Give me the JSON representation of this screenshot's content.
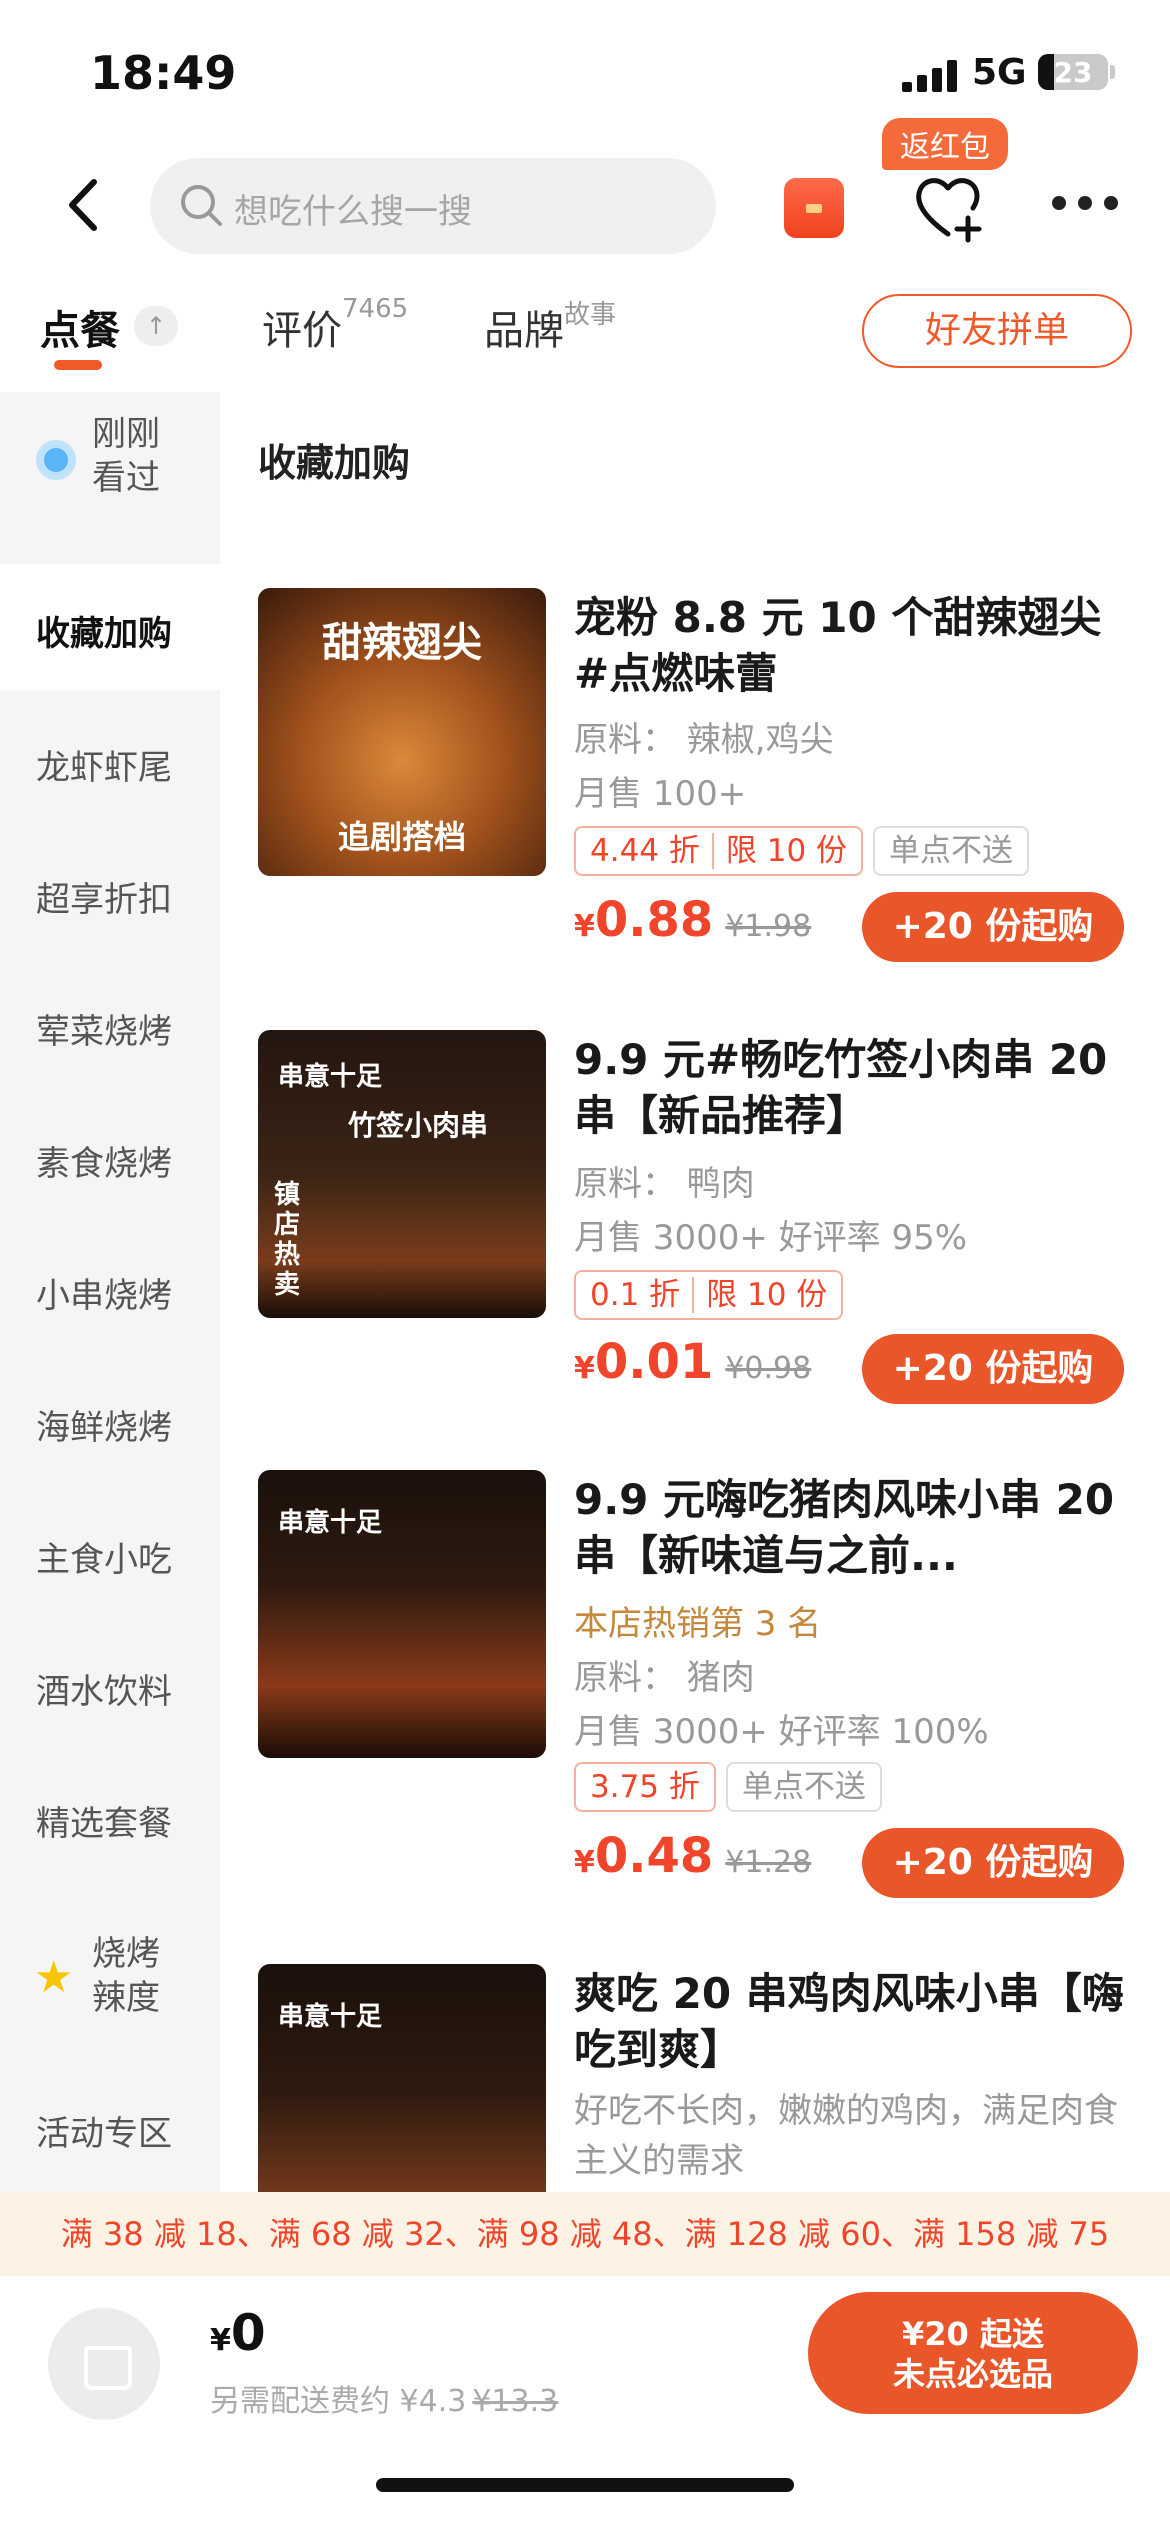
{
  "status_bar": {
    "time": "18:49",
    "network": "5G",
    "battery": "23",
    "battery_level": 0.23
  },
  "nav": {
    "search_placeholder": "想吃什么搜一搜",
    "fav_badge": "返红包"
  },
  "tabs": {
    "order": "点餐",
    "order_up": "↑",
    "reviews": "评价",
    "reviews_count": "7465",
    "brand": "品牌",
    "brand_sub": "故事",
    "friend_button": "好友拼单"
  },
  "sidebar": {
    "items": [
      {
        "line1": "刚刚",
        "line2": "看过"
      },
      {
        "label": "收藏加购"
      },
      {
        "label": "龙虾虾尾"
      },
      {
        "label": "超享折扣"
      },
      {
        "label": "荤菜烧烤"
      },
      {
        "label": "素食烧烤"
      },
      {
        "label": "小串烧烤"
      },
      {
        "label": "海鲜烧烤"
      },
      {
        "label": "主食小吃"
      },
      {
        "label": "酒水饮料"
      },
      {
        "label": "精选套餐"
      },
      {
        "line1": "烧烤",
        "line2": "辣度"
      },
      {
        "label": "活动专区"
      }
    ]
  },
  "section_title": "收藏加购",
  "products": [
    {
      "img_text": "甜辣翅尖",
      "img_sub": "追剧搭档",
      "title": "宠粉 8.8 元 10 个甜辣翅尖 #点燃味蕾",
      "ingredients": "原料：  辣椒,鸡尖",
      "sales": "月售 100+",
      "discount": "4.44 折",
      "limit": "限 10 份",
      "extra_tag": "单点不送",
      "currency": "¥",
      "price": "0.88",
      "old_price": "¥1.98",
      "buy": "+20 份起购"
    },
    {
      "img_text": "竹签小肉串",
      "img_brand": "串意十足",
      "img_side": "镇店热卖",
      "title": "9.9 元#畅吃竹签小肉串 20 串【新品推荐】",
      "ingredients": "原料：  鸭肉",
      "sales": "月售 3000+   好评率 95%",
      "discount": "0.1 折",
      "limit": "限 10 份",
      "currency": "¥",
      "price": "0.01",
      "old_price": "¥0.98",
      "buy": "+20 份起购"
    },
    {
      "img_brand": "串意十足",
      "title": "9.9 元嗨吃猪肉风味小串 20 串【新味道与之前...",
      "rank": "本店热销第 3 名",
      "ingredients": "原料：  猪肉",
      "sales": "月售 3000+   好评率 100%",
      "discount": "3.75 折",
      "extra_tag": "单点不送",
      "currency": "¥",
      "price": "0.48",
      "old_price": "¥1.28",
      "buy": "+20 份起购"
    },
    {
      "img_brand": "串意十足",
      "title": "爽吃 20 串鸡肉风味小串【嗨吃到爽】",
      "desc": "好吃不长肉，嫩嫩的鸡肉，满足肉食主义的需求"
    }
  ],
  "promo": "满 38 减 18、满 68 减 32、满 98 减 48、满 128 减 60、满 158 减 75",
  "bottom": {
    "currency": "¥",
    "total": "0",
    "fee_label": "另需配送费约 ¥4.3",
    "fee_old": "¥13.3",
    "checkout_line1": "¥20 起送",
    "checkout_line2": "未点必选品"
  },
  "colors": {
    "accent": "#e8562a",
    "price": "#f0452a",
    "promo_bg": "#fdf3e4"
  }
}
